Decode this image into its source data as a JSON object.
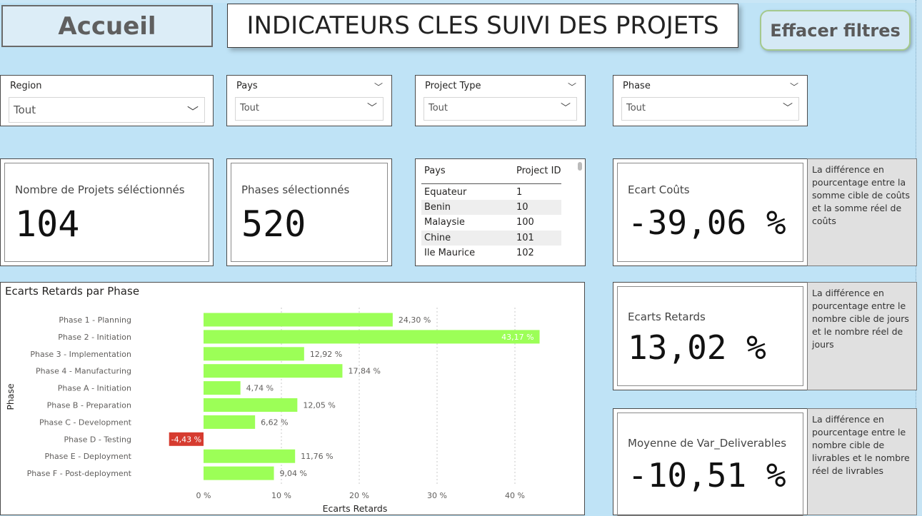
{
  "header": {
    "home_label": "Accueil",
    "title": "INDICATEURS CLES SUIVI DES PROJETS",
    "clear_filters_label": "Effacer filtres"
  },
  "filters": [
    {
      "label": "Region",
      "value": "Tout"
    },
    {
      "label": "Pays",
      "value": "Tout"
    },
    {
      "label": "Project Type",
      "value": "Tout"
    },
    {
      "label": "Phase",
      "value": "Tout"
    }
  ],
  "cards": {
    "projects": {
      "label": "Nombre de Projets séléctionnés",
      "value": "104"
    },
    "phases": {
      "label": "Phases sélectionnés",
      "value": "520"
    },
    "cost": {
      "label": "Ecart Coûts",
      "value": "-39,06 %",
      "description": "La différence en pourcentage entre la somme cible de coûts et la somme réel de coûts"
    },
    "delay": {
      "label": "Ecarts Retards",
      "value": "13,02 %",
      "description": "La différence en pourcentage entre le nombre cible de jours et le nombre réel de jours"
    },
    "deliverables": {
      "label": "Moyenne de Var_Deliverables",
      "value": "-10,51 %",
      "description": "La différence en pourcentage entre le nombre cible de livrables et le nombre réel de livrables"
    }
  },
  "table": {
    "columns": [
      "Pays",
      "Project ID"
    ],
    "rows": [
      [
        "Equateur",
        "1"
      ],
      [
        "Benin",
        "10"
      ],
      [
        "Malaysie",
        "100"
      ],
      [
        "Chine",
        "101"
      ],
      [
        "Ile Maurice",
        "102"
      ]
    ]
  },
  "colors": {
    "positive_bar": "#9cff57",
    "negative_bar": "#d63b2f",
    "background": "#bfe3f6"
  },
  "chart_data": {
    "type": "bar",
    "orientation": "horizontal",
    "title": "Ecarts Retards par Phase",
    "xlabel": "Ecarts Retards",
    "ylabel": "Phase",
    "categories": [
      "Phase 1 - Planning",
      "Phase 2 - Initiation",
      "Phase 3 - Implementation",
      "Phase 4 - Manufacturing",
      "Phase A - Initiation",
      "Phase B - Preparation",
      "Phase C - Development",
      "Phase D - Testing",
      "Phase E - Deployment",
      "Phase F - Post-deployment"
    ],
    "values": [
      24.3,
      43.17,
      12.92,
      17.84,
      4.74,
      12.05,
      6.62,
      -4.43,
      11.76,
      9.04
    ],
    "data_labels": [
      "24,30 %",
      "43,17 %",
      "12,92 %",
      "17,84 %",
      "4,74 %",
      "12,05 %",
      "6,62 %",
      "-4,43 %",
      "11,76 %",
      "9,04 %"
    ],
    "xticks": [
      0,
      10,
      20,
      30,
      40
    ],
    "xtick_labels": [
      "0 %",
      "10 %",
      "20 %",
      "30 %",
      "40 %"
    ],
    "grid": true
  }
}
